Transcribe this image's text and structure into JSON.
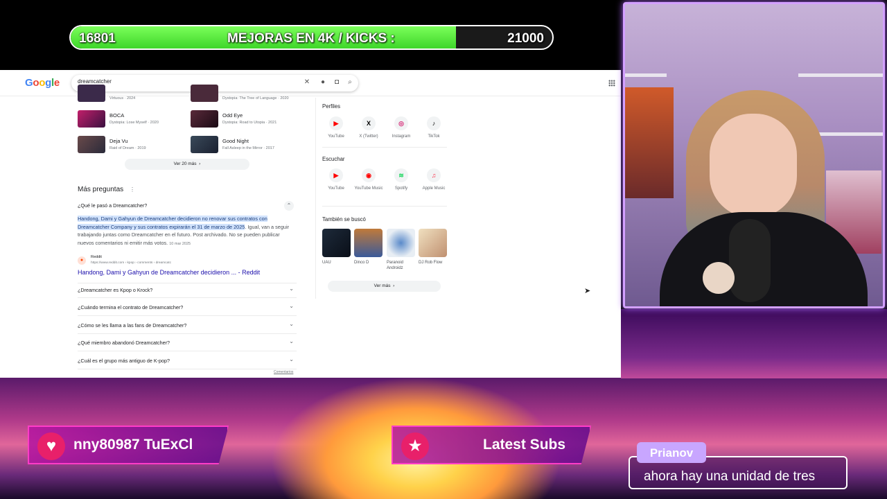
{
  "goal": {
    "current": "16801",
    "title": "MEJORAS EN 4K / KICKS :",
    "target": "21000",
    "progress": 0.8,
    "fill_color": "#4ce234"
  },
  "browser": {
    "logo": "Google",
    "search_query": "dreamcatcher",
    "top_items": [
      {
        "sub": "Virtuous · 2024"
      },
      {
        "sub": "Dystopia: The Tree of Language · 2020"
      }
    ],
    "songs": [
      {
        "title": "BOCA",
        "sub": "Dystopia: Lose Myself · 2020"
      },
      {
        "title": "Odd Eye",
        "sub": "Dystopia: Road to Utopia · 2021"
      },
      {
        "title": "Deja Vu",
        "sub": "Raid of Dream · 2019"
      },
      {
        "title": "Good Night",
        "sub": "Fall Asleep in the Mirror · 2017"
      }
    ],
    "see_more_songs": "Ver 20 más",
    "faq_heading": "Más preguntas",
    "faq_open": {
      "question": "¿Qué le pasó a Dreamcatcher?",
      "highlight": "Handong, Dami y Gahyun de Dreamcatcher decidieron no renovar sus contratos con Dreamcatcher Company y sus contratos expirarán el 31 de marzo de 2025",
      "rest": ". Igual, van a seguir trabajando juntas como Dreamcatcher en el futuro. Post archivado. No se pueden publicar nuevos comentarios ni emitir más votos.",
      "date": "10 mar 2025",
      "source_name": "Reddit",
      "source_url": "https://www.reddit.com › kpop › comments › dreamcatc",
      "source_title": "Handong, Dami y Gahyun de Dreamcatcher decidieron ... - Reddit"
    },
    "faq_questions": [
      "¿Dreamcatcher es Kpop o Krock?",
      "¿Cuándo termina el contrato de Dreamcatcher?",
      "¿Cómo se les llama a las fans de Dreamcatcher?",
      "¿Qué miembro abandonó Dreamcatcher?",
      "¿Cuál es el grupo más antiguo de K-pop?"
    ],
    "feedback": "Comentarios",
    "profiles_heading": "Perfiles",
    "profiles": [
      {
        "label": "YouTube",
        "icon": "youtube-icon",
        "glyph": "▶",
        "color": "#ff0000"
      },
      {
        "label": "X (Twitter)",
        "icon": "x-twitter-icon",
        "glyph": "X",
        "color": "#000000"
      },
      {
        "label": "Instagram",
        "icon": "instagram-icon",
        "glyph": "◎",
        "color": "#d62976"
      },
      {
        "label": "TikTok",
        "icon": "tiktok-icon",
        "glyph": "♪",
        "color": "#000000"
      }
    ],
    "listen_heading": "Escuchar",
    "listen": [
      {
        "label": "YouTube",
        "icon": "youtube-icon",
        "glyph": "▶",
        "color": "#ff0000"
      },
      {
        "label": "YouTube Music",
        "icon": "youtube-music-icon",
        "glyph": "◉",
        "color": "#ff0000"
      },
      {
        "label": "Spotify",
        "icon": "spotify-icon",
        "glyph": "≋",
        "color": "#1ed760"
      },
      {
        "label": "Apple Music",
        "icon": "apple-music-icon",
        "glyph": "♫",
        "color": "#fa2d48"
      }
    ],
    "also_heading": "También se buscó",
    "also": [
      {
        "label": "UAU"
      },
      {
        "label": "Dinco D"
      },
      {
        "label": "Paranoid Androidz"
      },
      {
        "label": "DJ Rob Flow"
      }
    ],
    "see_more": "Ver más"
  },
  "overlay": {
    "ticker": "nny80987   TuExCl",
    "latest_subs": "Latest Subs",
    "chat_name": "Prianov",
    "chat_message": "ahora hay una unidad de tres"
  }
}
